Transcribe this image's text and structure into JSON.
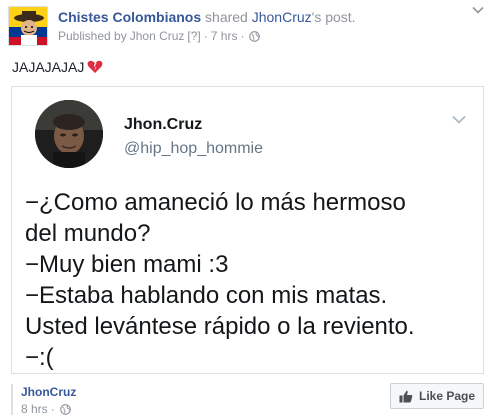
{
  "post": {
    "page_name": "Chistes Colombianos",
    "shared_text": "shared",
    "source_name": "JhonCruz",
    "source_suffix": "'s post.",
    "published_prefix": "Published by",
    "published_by": "Jhon Cruz",
    "published_marker": "[?]",
    "separator": "·",
    "time": "7 hrs",
    "text": "JAJAJAJAJ",
    "text_emoji": "broken-heart-icon"
  },
  "shared_card": {
    "tweet_name": "Jhon.Cruz",
    "tweet_handle": "@hip_hop_hommie",
    "tweet_lines": [
      "−¿Como amaneció lo más hermoso",
      "del mundo?",
      "−Muy bien mami :3",
      "−Estaba hablando con mis matas.",
      "Usted levántese rápido o la revientο.",
      "−:("
    ]
  },
  "share_footer": {
    "name": "JhonCruz",
    "time": "8 hrs",
    "separator": "·",
    "like_page_label": "Like Page"
  },
  "colors": {
    "link_blue": "#365899",
    "meta_gray": "#90949c",
    "text_dark": "#1d2129",
    "border": "#dddfe2",
    "button_bg": "#f6f7f9"
  }
}
